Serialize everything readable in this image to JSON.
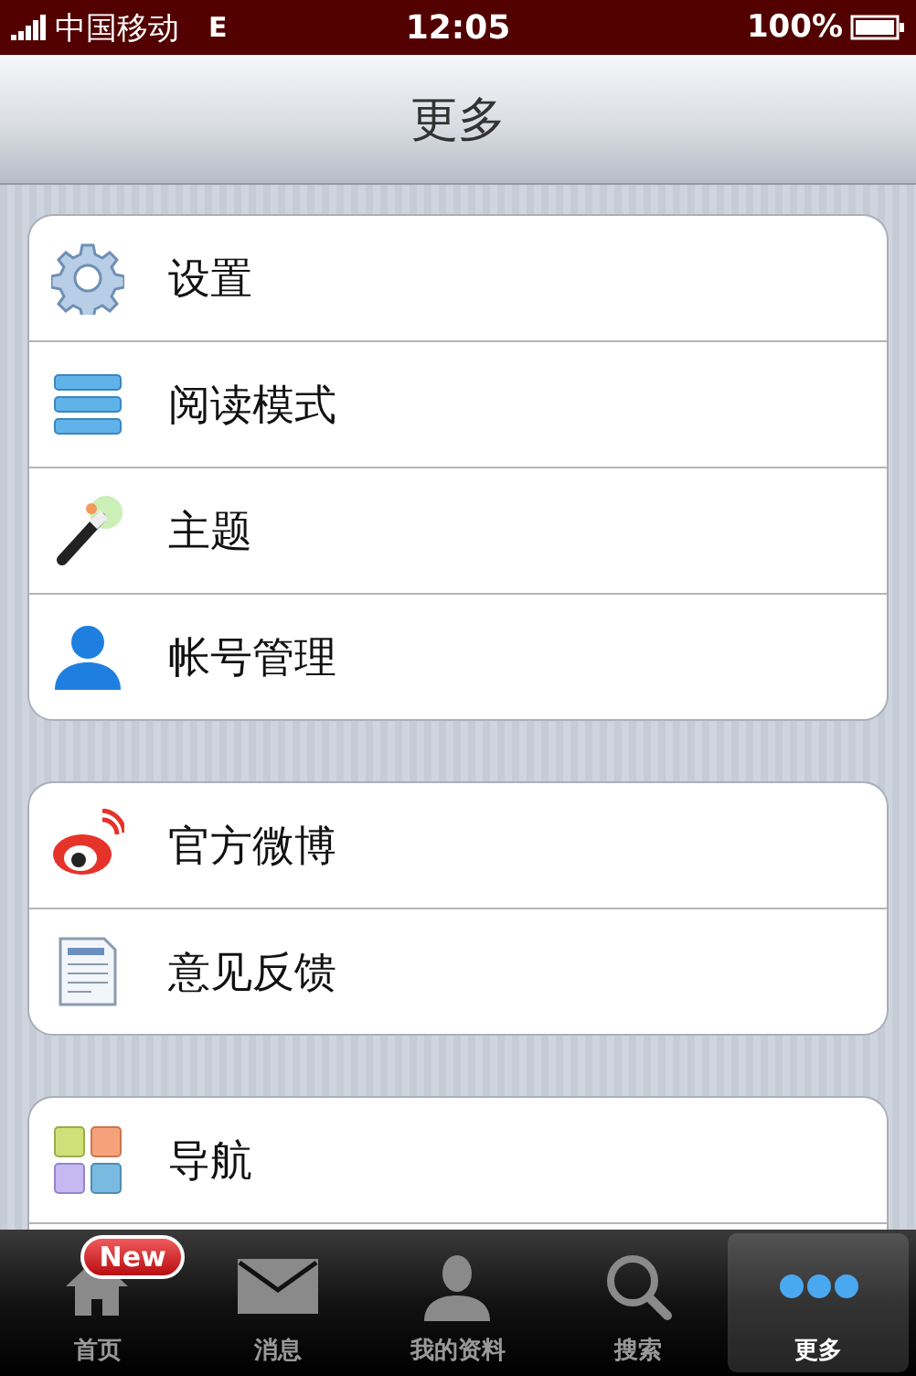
{
  "status_bar": {
    "carrier": "中国移动",
    "network": "E",
    "time": "12:05",
    "battery": "100%"
  },
  "nav_bar": {
    "title": "更多"
  },
  "groups": [
    {
      "items": [
        {
          "kind": "gear",
          "label": "设置"
        },
        {
          "kind": "list",
          "label": "阅读模式"
        },
        {
          "kind": "wand",
          "label": "主题"
        },
        {
          "kind": "person",
          "label": "帐号管理"
        }
      ]
    },
    {
      "items": [
        {
          "kind": "weibo",
          "label": "官方微博"
        },
        {
          "kind": "document",
          "label": "意见反馈"
        }
      ]
    },
    {
      "items": [
        {
          "kind": "grid",
          "label": "导航"
        }
      ]
    }
  ],
  "tab_bar": [
    {
      "kind": "home",
      "label": "首页",
      "badge": "New",
      "selected": false
    },
    {
      "kind": "mail",
      "label": "消息",
      "selected": false
    },
    {
      "kind": "person",
      "label": "我的资料",
      "selected": false
    },
    {
      "kind": "search",
      "label": "搜索",
      "selected": false
    },
    {
      "kind": "more",
      "label": "更多",
      "selected": true
    }
  ]
}
